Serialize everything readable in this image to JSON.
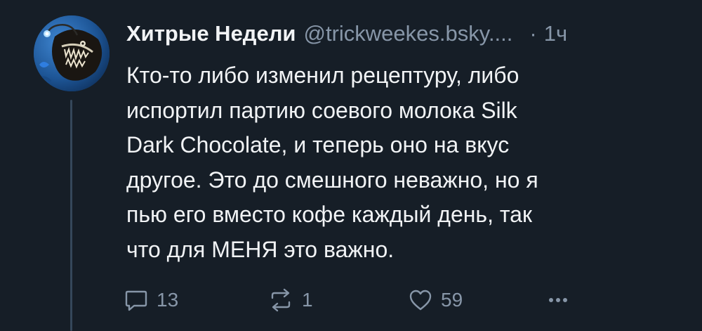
{
  "post": {
    "author": {
      "display_name": "Хитрые Недели",
      "handle": "@trickweekes.bsky...."
    },
    "separator": "·",
    "timestamp": "1ч",
    "text": "Кто-то либо изменил рецептуру, либо\nиспортил партию соевого молока Silk\nDark Chocolate, и теперь оно на вкус\nдругое. Это до смешного неважно, но я\nпью его вместо кофе каждый день, так\nчто для МЕНЯ это важно.",
    "actions": {
      "reply": {
        "icon": "reply-icon",
        "count": "13"
      },
      "repost": {
        "icon": "repost-icon",
        "count": "1"
      },
      "like": {
        "icon": "heart-icon",
        "count": "59"
      },
      "more": {
        "icon": "more-icon"
      }
    }
  },
  "colors": {
    "background": "#161e27",
    "text": "#f1f3f5",
    "muted": "#8796a8",
    "thread_line": "#35475a"
  }
}
